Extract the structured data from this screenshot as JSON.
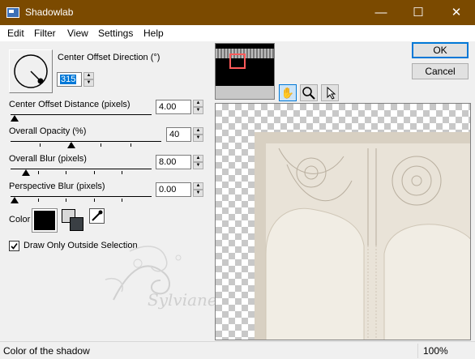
{
  "window": {
    "title": "Shadowlab",
    "minimize": "—",
    "maximize": "☐",
    "close": "✕",
    "titlebar_color": "#7b4a00"
  },
  "menu": [
    "Edit",
    "Filter",
    "View",
    "Settings",
    "Help"
  ],
  "controls": {
    "direction": {
      "label": "Center Offset Direction (°)",
      "value": "315"
    },
    "distance": {
      "label": "Center Offset Distance (pixels)",
      "value": "4.00"
    },
    "opacity": {
      "label": "Overall Opacity (%)",
      "value": "40"
    },
    "blur": {
      "label": "Overall Blur (pixels)",
      "value": "8.00"
    },
    "perspective": {
      "label": "Perspective Blur (pixels)",
      "value": "0.00"
    },
    "color": {
      "label": "Color",
      "value": "#000000"
    },
    "draw_outside": {
      "label": "Draw Only Outside Selection",
      "checked": true
    }
  },
  "buttons": {
    "ok": "OK",
    "cancel": "Cancel"
  },
  "tools": [
    "hand-icon",
    "zoom-icon",
    "arrow-icon"
  ],
  "watermark": "Sylviane",
  "status": {
    "text": "Color of the shadow",
    "zoom": "100%"
  }
}
